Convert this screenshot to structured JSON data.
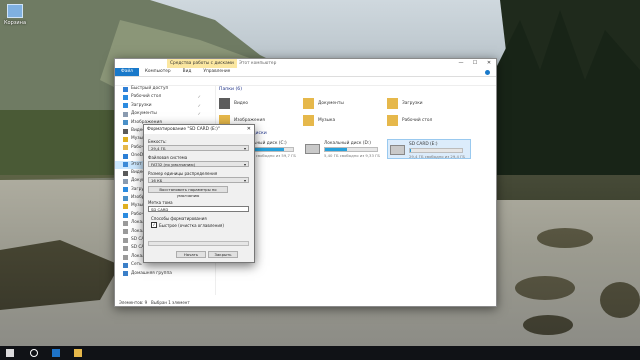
{
  "desktop": {
    "icon_label": "Корзина"
  },
  "window": {
    "context_tab": "Средства работы с дисками",
    "title": "Этот компьютер",
    "controls": [
      "—",
      "☐",
      "✕"
    ],
    "ribbon_tabs": [
      "Файл",
      "Компьютер",
      "Вид",
      "Управление"
    ]
  },
  "sidebar": {
    "items": [
      {
        "label": "Быстрый доступ",
        "icon": "star-icon",
        "color": "#2f7fd6",
        "pin": ""
      },
      {
        "label": "Рабочий стол",
        "icon": "desktop-icon",
        "color": "#2b8be0",
        "pin": "✓"
      },
      {
        "label": "Загрузки",
        "icon": "download-icon",
        "color": "#2b8be0",
        "pin": "✓"
      },
      {
        "label": "Документы",
        "icon": "documents-icon",
        "color": "#8a9bb0",
        "pin": "✓"
      },
      {
        "label": "Изображения",
        "icon": "pictures-icon",
        "color": "#4a90c8",
        "pin": ""
      },
      {
        "label": "Видео",
        "icon": "video-icon",
        "color": "#5a5a5a",
        "pin": ""
      },
      {
        "label": "Музыка",
        "icon": "music-icon",
        "color": "#e0b020",
        "pin": ""
      },
      {
        "label": "Рабочий стол",
        "icon": "folder-icon",
        "color": "#e6b84b",
        "pin": ""
      },
      {
        "label": "OneDrive",
        "icon": "cloud-icon",
        "color": "#2b7fd6",
        "pin": ""
      },
      {
        "label": "Этот компьютер",
        "icon": "computer-icon",
        "color": "#3b8ad8",
        "pin": "",
        "selected": true
      },
      {
        "label": "Видео",
        "icon": "video-icon",
        "color": "#5a5a5a",
        "pin": ""
      },
      {
        "label": "Документы",
        "icon": "documents-icon",
        "color": "#8a9bb0",
        "pin": ""
      },
      {
        "label": "Загрузки",
        "icon": "download-icon",
        "color": "#2b8be0",
        "pin": ""
      },
      {
        "label": "Изображения",
        "icon": "pictures-icon",
        "color": "#4a90c8",
        "pin": ""
      },
      {
        "label": "Музыка",
        "icon": "music-icon",
        "color": "#e0b020",
        "pin": ""
      },
      {
        "label": "Рабочий стол",
        "icon": "desktop-icon",
        "color": "#2b8be0",
        "pin": ""
      },
      {
        "label": "Локальный диск (C:)",
        "icon": "drive-icon",
        "color": "#9a9a9a",
        "pin": ""
      },
      {
        "label": "Локальный диск (D:)",
        "icon": "drive-icon",
        "color": "#9a9a9a",
        "pin": ""
      },
      {
        "label": "SD CARD (E:)",
        "icon": "drive-icon",
        "color": "#9a9a9a",
        "pin": ""
      },
      {
        "label": "SD CARD (E:)",
        "icon": "drive-icon",
        "color": "#9a9a9a",
        "pin": ""
      },
      {
        "label": "Локальный диск (D:)",
        "icon": "drive-icon",
        "color": "#9a9a9a",
        "pin": ""
      },
      {
        "label": "Сеть",
        "icon": "network-icon",
        "color": "#3b7fc8",
        "pin": ""
      },
      {
        "label": "Домашняя группа",
        "icon": "homegroup-icon",
        "color": "#3b7fc8",
        "pin": ""
      }
    ]
  },
  "main": {
    "folders_header": "Папки (6)",
    "folders": [
      {
        "label": "Видео",
        "icon": "video-folder-icon",
        "color": "#5c5c5c"
      },
      {
        "label": "Документы",
        "icon": "documents-folder-icon",
        "color": "#e6b84b"
      },
      {
        "label": "Загрузки",
        "icon": "downloads-folder-icon",
        "color": "#e6b84b"
      },
      {
        "label": "Изображения",
        "icon": "pictures-folder-icon",
        "color": "#e6b84b"
      },
      {
        "label": "Музыка",
        "icon": "music-folder-icon",
        "color": "#e6b84b"
      },
      {
        "label": "Рабочий стол",
        "icon": "desktop-folder-icon",
        "color": "#e6b84b"
      }
    ],
    "devices_header": "Устройства и диски",
    "drives": [
      {
        "name": "Локальный диск (C:)",
        "free": "11,0 ГБ свободно из 59,7 ГБ",
        "used": 0.82
      },
      {
        "name": "Локальный диск (D:)",
        "free": "5,40 ГБ свободно из 9,33 ГБ",
        "used": 0.42
      },
      {
        "name": "SD CARD (E:)",
        "free": "29,4 ГБ свободно из 29,4 ГБ",
        "used": 0.02,
        "selected": true
      }
    ],
    "status_count": "Элементов: 9",
    "status_selected": "Выбран 1 элемент"
  },
  "dialog": {
    "title": "Форматирование \"SD CARD (E:)\"",
    "capacity_label": "Емкость:",
    "capacity_value": "29,4 ГБ",
    "fs_label": "Файловая система",
    "fs_value": "FAT32 (по умолчанию)",
    "cluster_label": "Размер единицы распределения",
    "cluster_value": "16 КБ",
    "restore_button": "Восстановить параметры по умолчанию",
    "volume_label": "Метка тома",
    "volume_value": "SD CARD",
    "format_options_label": "Способы форматирования",
    "quick_format_label": "Быстрое (очистка оглавления)",
    "quick_format_checked": "✓",
    "start_button": "Начать",
    "close_button": "Закрыть",
    "progress": 0
  },
  "taskbar": {
    "time": "",
    "date": ""
  }
}
